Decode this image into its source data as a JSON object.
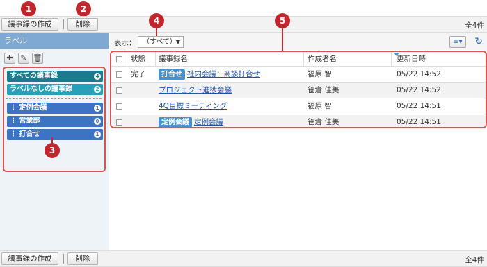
{
  "toolbar": {
    "create_label": "議事録の作成",
    "delete_label": "削除",
    "count_label": "全4件"
  },
  "callouts": [
    "1",
    "2",
    "3",
    "4",
    "5"
  ],
  "sidebar": {
    "title": "ラベル",
    "tools": [
      {
        "name": "add-icon",
        "glyph": "✚"
      },
      {
        "name": "edit-icon",
        "glyph": "✎"
      },
      {
        "name": "trash-icon",
        "glyph": "🗑"
      }
    ],
    "labels": [
      {
        "label": "すべての議事録",
        "count": "4",
        "color": "#1b7a8c"
      },
      {
        "label": "ラベルなしの議事録",
        "count": "2",
        "color": "#2aa0b8"
      },
      {
        "label": "定例会議",
        "count": "1",
        "color": "#3d73c4"
      },
      {
        "label": "営業部",
        "count": "0",
        "color": "#3d73c4"
      },
      {
        "label": "打合せ",
        "count": "1",
        "color": "#3d73c4"
      }
    ]
  },
  "filter": {
    "label": "表示：",
    "selected": "（すべて）",
    "chevron": "▼"
  },
  "view_toggle": "≡▾",
  "refresh_icon": "↻",
  "table": {
    "headers": [
      "状態",
      "議事録名",
      "作成者名",
      "更新日時"
    ],
    "rows": [
      {
        "status": "完了",
        "tag": "打合せ",
        "title": "社内会議：商談打合せ",
        "author": "福原 智",
        "updated": "05/22 14:52"
      },
      {
        "status": "",
        "tag": "",
        "title": "プロジェクト進捗会議",
        "author": "笹倉 佳美",
        "updated": "05/22 14:52"
      },
      {
        "status": "",
        "tag": "",
        "title": "4Q目標ミーティング",
        "author": "福原 智",
        "updated": "05/22 14:51"
      },
      {
        "status": "",
        "tag": "定例会議",
        "title": "定例会議",
        "author": "笹倉 佳美",
        "updated": "05/22 14:51"
      }
    ]
  },
  "colors": {
    "accent": "#c0262b",
    "sidebar_header": "#7fa9d3",
    "tag": "#4a90c9",
    "link": "#2255aa"
  }
}
